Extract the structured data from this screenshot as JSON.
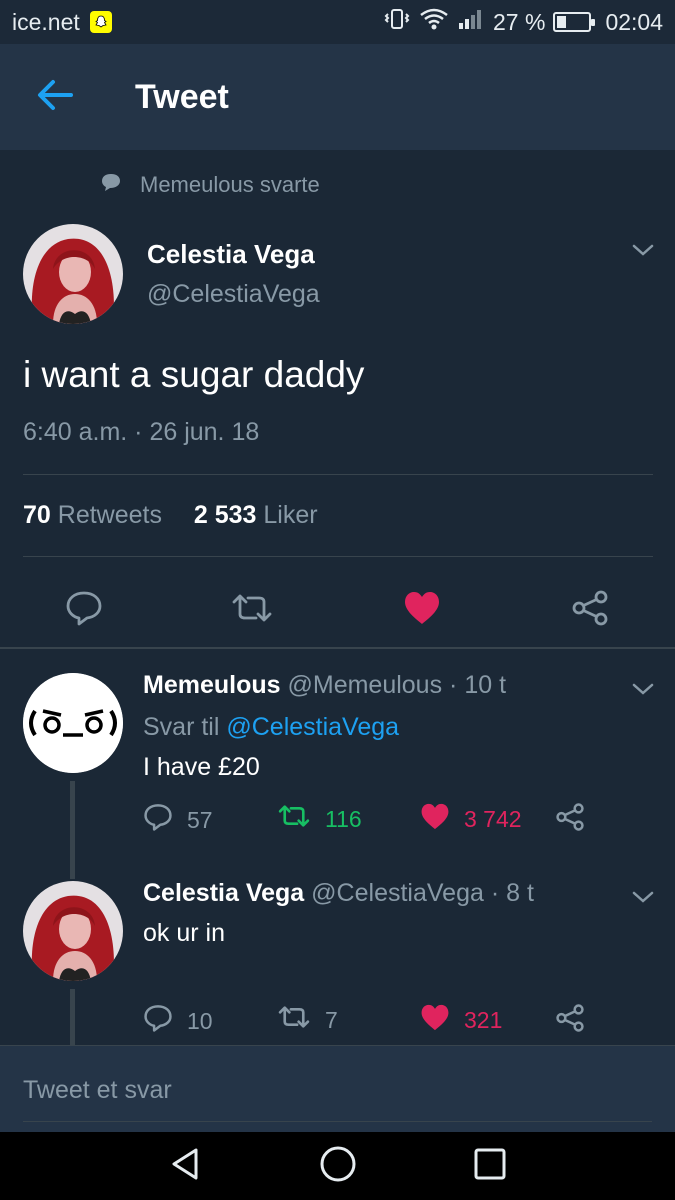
{
  "status_bar": {
    "carrier": "ice.net",
    "battery_level_pct": 27,
    "battery_text": "27 %",
    "time": "02:04"
  },
  "app_bar": {
    "title": "Tweet"
  },
  "tweet": {
    "reply_context": "Memeulous svarte",
    "author_name": "Celestia Vega",
    "author_handle": "@CelestiaVega",
    "text": "i want a sugar daddy",
    "timestamp": "6:40 a.m. · 26 jun. 18",
    "retweet_count": "70",
    "retweet_label": "Retweets",
    "like_count": "2 533",
    "like_label": "Liker",
    "liked": true
  },
  "replies": [
    {
      "name": "Memeulous",
      "handle": "@Memeulous",
      "time": "· 10 t",
      "reply_to_prefix": "Svar til",
      "reply_to_handle": "@CelestiaVega",
      "text": "I have £20",
      "reply_count": "57",
      "retweet_count": "116",
      "like_count": "3 742",
      "avatar_text": "(ಠ‿ಠ)"
    },
    {
      "name": "Celestia Vega",
      "handle": "@CelestiaVega",
      "time": "· 8 t",
      "text": "ok ur in",
      "reply_count": "10",
      "retweet_count": "7",
      "like_count": "321"
    }
  ],
  "compose": {
    "placeholder": "Tweet et svar"
  },
  "colors": {
    "background": "#1b2836",
    "app_bar": "#243447",
    "accent_blue": "#1da1f2",
    "like_red": "#e0245e",
    "retweet_green": "#17bf63",
    "secondary_text": "#8899a6"
  }
}
